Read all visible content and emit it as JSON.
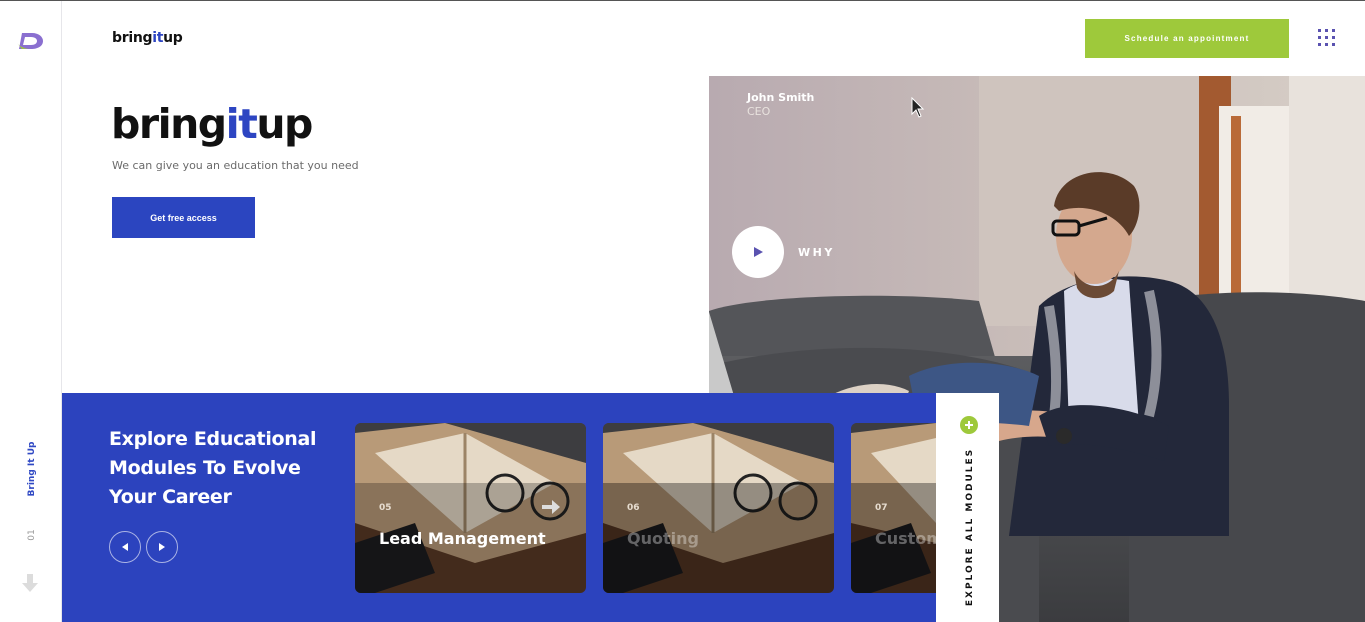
{
  "sidebar": {
    "logo_icon": "bringitup-logo-icon",
    "vertical_label": "Bring It Up",
    "slide_number": "01",
    "scroll_icon": "arrow-down-icon"
  },
  "header": {
    "brand_prefix": "bring",
    "brand_accent": "it",
    "brand_suffix": "up",
    "schedule_button": "Schedule an appointment",
    "menu_icon": "grid-menu-icon"
  },
  "hero": {
    "brand_prefix": "bring",
    "brand_accent": "it",
    "brand_suffix": "up",
    "tagline": "We can give you an education that you need",
    "cta_button": "Get free access",
    "person_name": "John Smith",
    "person_role": "CEO",
    "play_icon": "play-icon",
    "play_label": "WHY"
  },
  "modules": {
    "title": "Explore Educational Modules To Evolve Your Career",
    "prev_icon": "chevron-left-icon",
    "next_icon": "chevron-right-icon",
    "cards": [
      {
        "number": "05",
        "title": "Lead Management",
        "active": true
      },
      {
        "number": "06",
        "title": "Quoting",
        "active": false
      },
      {
        "number": "07",
        "title": "Custom Loan Ex",
        "active": false
      }
    ],
    "explore_all": "EXPLORE ALL MODULES",
    "explore_icon": "plus-icon"
  },
  "colors": {
    "brand_blue": "#2c43be",
    "accent_green": "#9ec93b",
    "menu_purple": "#5a52b0"
  }
}
